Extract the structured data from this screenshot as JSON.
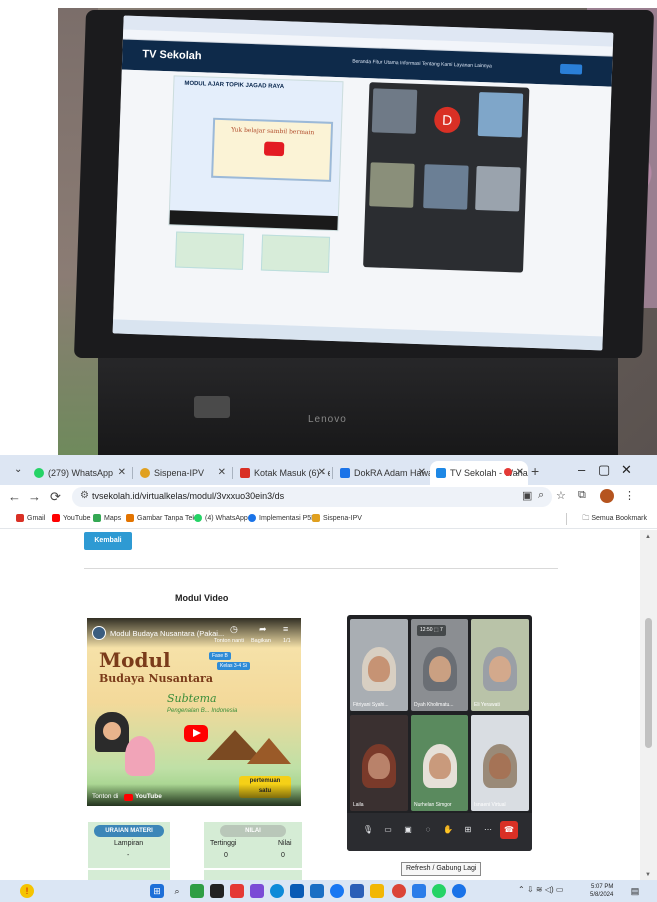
{
  "photo": {
    "laptop_brand": "Lenovo",
    "screen": {
      "site_brand": "TV Sekolah",
      "nav": "Beranda   Fitur Utama   Informasi   Tentang Kami   Layanan Lainnya",
      "video_title": "MODUL AJAR TOPIK JAGAD RAYA",
      "board_text": "Yuk belajar sambil bermain",
      "avatar_letter": "D"
    }
  },
  "tabs": [
    {
      "label": "(279) WhatsApp",
      "color": "#25d366"
    },
    {
      "label": "Sispena-IPV",
      "color": "#e0a020"
    },
    {
      "label": "Kotak Masuk (6) - eistpu",
      "color": "#d93025"
    },
    {
      "label": "DokRA Adam Hawa 1 - G",
      "color": "#1a73e8"
    },
    {
      "label": "TV Sekolah - Wahana",
      "color": "#1e88e5"
    }
  ],
  "window": {
    "minimize": "–",
    "maximize": "▢",
    "close": "✕",
    "new_tab": "+"
  },
  "address": {
    "url": "tvsekolah.id/virtualkelas/modul/3vxxuo30ein3/ds"
  },
  "bookmarks": [
    {
      "label": "Gmail",
      "color": "#d93025"
    },
    {
      "label": "YouTube",
      "color": "#ff0000"
    },
    {
      "label": "Maps",
      "color": "#34a853"
    },
    {
      "label": "Gambar Tanpa Teks",
      "color": "#e37400"
    },
    {
      "label": "(4) WhatsApp",
      "color": "#25d366"
    },
    {
      "label": "Implementasi P5P",
      "color": "#1a73e8"
    },
    {
      "label": "Sispena-IPV",
      "color": "#e0a020"
    }
  ],
  "bookmarks_all": "Semua Bookmark",
  "page": {
    "back_button": "Kembali",
    "section_title": "Modul Video",
    "video": {
      "title": "Modul Budaya Nusantara (Pakai...",
      "watch_later": "Tonton nanti",
      "share": "Bagikan",
      "counter": "1/1",
      "modul": "Modul",
      "budaya": "Budaya Nusantara",
      "fase": "Fase B",
      "kelas": "Kelas 3-4 Si",
      "subtema": "Subtema",
      "subtema_sub": "Pengenalan B... Indonesia",
      "pertemuan_1": "pertemuan",
      "pertemuan_2": "satu",
      "tonton_di": "Tonton di",
      "youtube": "YouTube"
    },
    "cards": {
      "uraian_header": "URAIAN MATERI",
      "lampiran_label": "Lampiran",
      "lampiran_value": "-",
      "nilai_header": "NILAI",
      "tertinggi_label": "Tertinggi",
      "tertinggi_value": "0",
      "nilai_label": "Nilai",
      "nilai_value": "0"
    },
    "meet": {
      "timer": "12:50",
      "count": "7",
      "participants": [
        "Fitriyani Syahi...",
        "Dyah Kholimatu...",
        "Eli Yerawati",
        "Laila",
        "Nurhelan Simgor",
        "Isnaeni Virtual"
      ]
    },
    "tooltip": "Refresh / Gabung Lagi"
  },
  "taskbar": {
    "time": "5:07 PM",
    "date": "5/8/2024"
  }
}
